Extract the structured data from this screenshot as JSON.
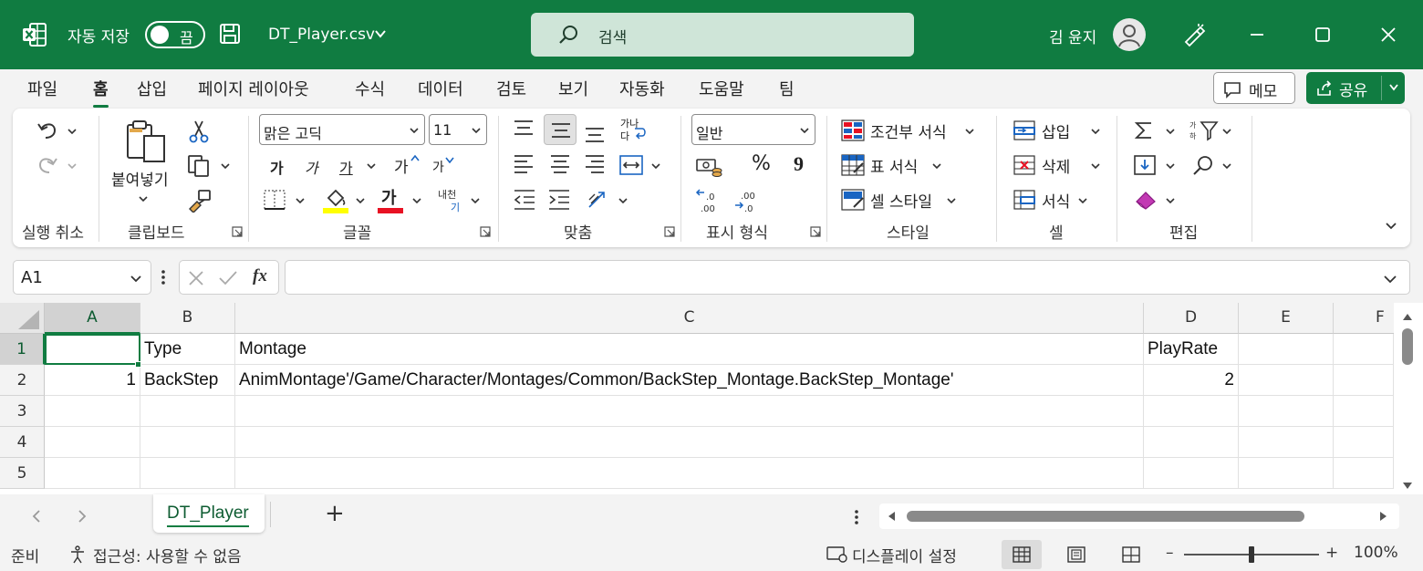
{
  "titlebar": {
    "autosave_label": "자동 저장",
    "autosave_state": "끔",
    "filename": "DT_Player.csv",
    "search_placeholder": "검색",
    "user_name": "김 윤지"
  },
  "menu": {
    "tabs": [
      "파일",
      "홈",
      "삽입",
      "페이지 레이아웃",
      "수식",
      "데이터",
      "검토",
      "보기",
      "자동화",
      "도움말",
      "팀"
    ],
    "active_tab": "홈",
    "comment_label": "메모",
    "share_label": "공유"
  },
  "ribbon": {
    "groups": {
      "undo": "실행 취소",
      "clipboard": "클립보드",
      "font": "글꼴",
      "alignment": "맞춤",
      "number": "표시 형식",
      "styles": "스타일",
      "cells": "셀",
      "editing": "편집"
    },
    "paste_label": "붙여넣기",
    "font_name": "맑은 고딕",
    "font_size": "11",
    "number_format": "일반",
    "font_buttons": {
      "bold": "가",
      "italic": "가",
      "underline": "가",
      "grow": "가",
      "shrink": "가",
      "font_color": "가"
    },
    "phonetic": {
      "top": "내천",
      "bottom": "기"
    },
    "wrap_glyph_top": "가나",
    "wrap_glyph_bottom": "다",
    "conditional_format": "조건부 서식",
    "format_as_table": "표 서식",
    "cell_styles": "셀 스타일",
    "insert": "삽입",
    "delete": "삭제",
    "format": "서식",
    "number_glyphs": {
      "percent": "%",
      "comma": "9",
      "inc": ".00",
      "dec": ".00"
    }
  },
  "formula_bar": {
    "name_box": "A1",
    "fx": "fx",
    "formula": ""
  },
  "sheet": {
    "columns": [
      "A",
      "B",
      "C",
      "D",
      "E",
      "F"
    ],
    "rows": [
      "1",
      "2",
      "3",
      "4",
      "5"
    ],
    "cells": {
      "B1": "Type",
      "C1": "Montage",
      "D1": "PlayRate",
      "A2": "1",
      "B2": "BackStep",
      "C2": "AnimMontage'/Game/Character/Montages/Common/BackStep_Montage.BackStep_Montage'",
      "D2": "2"
    },
    "active_cell": "A1"
  },
  "sheet_tabs": {
    "tabs": [
      "DT_Player"
    ],
    "add_glyph": "+"
  },
  "statusbar": {
    "ready": "준비",
    "accessibility": "접근성: 사용할 수 없음",
    "display_settings": "디스플레이 설정",
    "zoom": "100%",
    "zoom_minus": "–",
    "zoom_plus": "+"
  },
  "colors": {
    "brand": "#107c41",
    "brand_dark": "#0e5c32",
    "search_bg": "#cfe5d8"
  }
}
